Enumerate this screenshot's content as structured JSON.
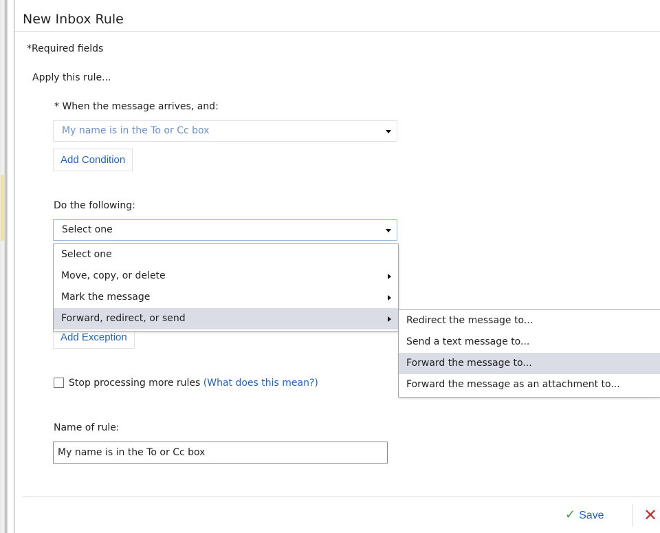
{
  "dialog": {
    "title": "New Inbox Rule",
    "required_note": "*Required fields",
    "apply_label": "Apply this rule..."
  },
  "condition": {
    "label": "* When the message arrives, and:",
    "selected": "My name is in the To or Cc box",
    "add_button": "Add Condition"
  },
  "action": {
    "label": "Do the following:",
    "selected": "Select one",
    "menu_items": [
      {
        "label": "Select one"
      },
      {
        "label": "Move, copy, or delete"
      },
      {
        "label": "Mark the message"
      },
      {
        "label": "Forward, redirect, or send"
      }
    ],
    "submenu_items": [
      {
        "label": "Redirect the message to..."
      },
      {
        "label": "Send a text message to..."
      },
      {
        "label": "Forward the message to..."
      },
      {
        "label": "Forward the message as an attachment to..."
      }
    ]
  },
  "exception": {
    "add_button": "Add Exception"
  },
  "stop_processing": {
    "label": "Stop processing more rules",
    "help_link": "(What does this mean?)"
  },
  "rule_name": {
    "label": "Name of rule:",
    "value": "My name is in the To or Cc box"
  },
  "footer": {
    "save_label": "Save"
  },
  "colors": {
    "link": "#1e63c2",
    "highlight": "#dadde5",
    "save_check": "#3aa53a",
    "discard": "#c9302c"
  },
  "icons": [
    "dropdown-caret-icon",
    "submenu-arrow-icon",
    "checkmark-icon",
    "close-icon"
  ]
}
